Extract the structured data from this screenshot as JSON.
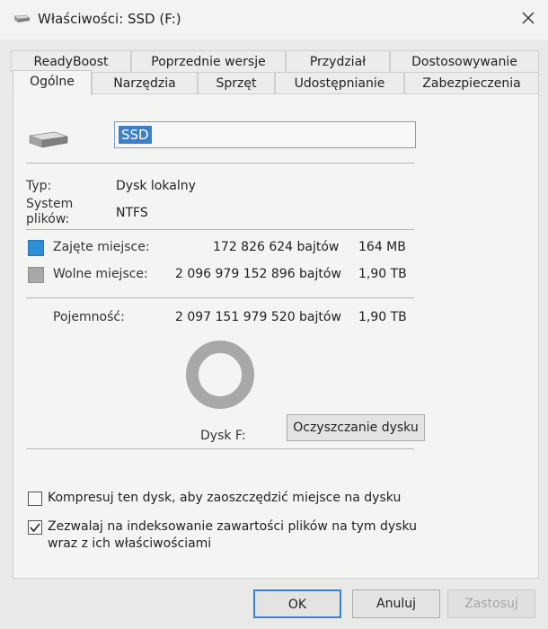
{
  "window": {
    "title": "Właściwości: SSD (F:)",
    "icon": "drive-icon",
    "close_label": "✕"
  },
  "tabs_row1": [
    "ReadyBoost",
    "Poprzednie wersje",
    "Przydział",
    "Dostosowywanie"
  ],
  "tabs_row2": [
    "Ogólne",
    "Narzędzia",
    "Sprzęt",
    "Udostępnianie",
    "Zabezpieczenia"
  ],
  "active_tab": "Ogólne",
  "general": {
    "name_value": "SSD",
    "type_label": "Typ:",
    "type_value": "Dysk lokalny",
    "fs_label_line1": "System",
    "fs_label_line2": "plików:",
    "fs_value": "NTFS",
    "used_label": "Zajęte miejsce:",
    "used_bytes": "172 826 624 bajtów",
    "used_size": "164 MB",
    "free_label": "Wolne miejsce:",
    "free_bytes": "2 096 979 152 896 bajtów",
    "free_size": "1,90 TB",
    "capacity_label": "Pojemność:",
    "capacity_bytes": "2 097 151 979 520 bajtów",
    "capacity_size": "1,90 TB",
    "drive_label": "Dysk F:",
    "cleanup_button": "Oczyszczanie dysku",
    "used_fraction": 8.24e-05,
    "colors": {
      "used": "#2d8fd8",
      "free": "#a8a8a6"
    }
  },
  "options": {
    "compress_label": "Kompresuj ten dysk, aby zaoszczędzić miejsce na dysku",
    "compress_checked": false,
    "index_label_line1": "Zezwalaj na indeksowanie zawartości plików na tym dysku",
    "index_label_line2": "wraz z ich właściwościami",
    "index_checked": true
  },
  "buttons": {
    "ok": "OK",
    "cancel": "Anuluj",
    "apply": "Zastosuj"
  }
}
